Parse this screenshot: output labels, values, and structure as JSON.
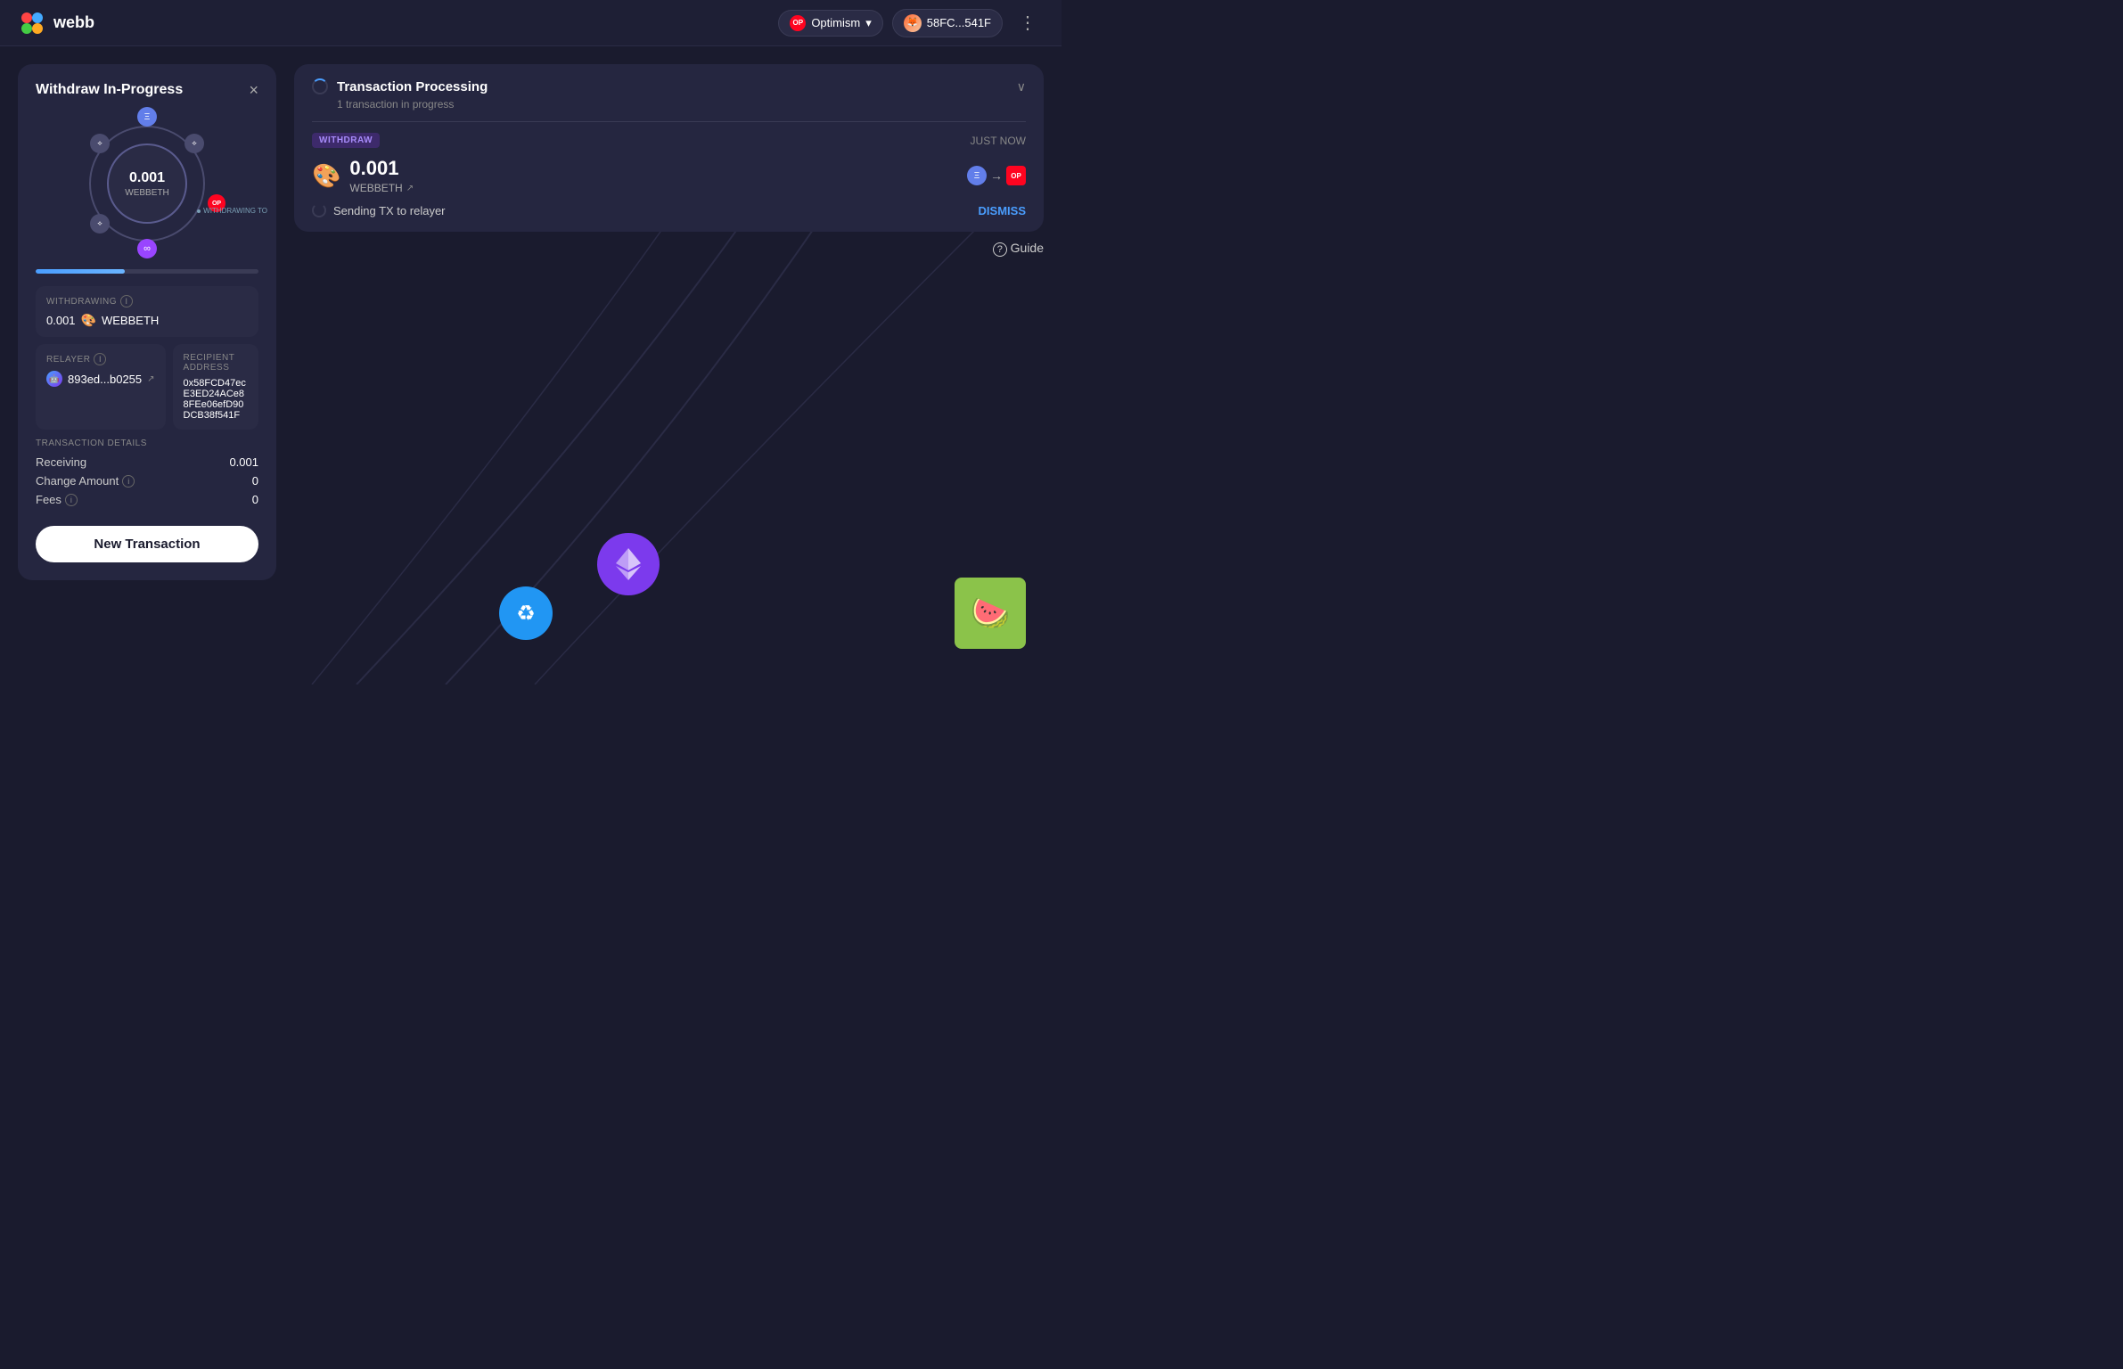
{
  "app": {
    "name": "webb",
    "logo_text": "webb"
  },
  "header": {
    "network_label": "Optimism",
    "wallet_address": "58FC...541F",
    "more_icon": "⋮"
  },
  "withdraw_panel": {
    "title": "Withdraw In-Progress",
    "close_icon": "×",
    "amount": "0.001",
    "token": "WEBBETH",
    "withdrawing_to_label": "WITHDRAWING TO",
    "progress_percent": 40,
    "withdrawing_section": {
      "label": "WITHDRAWING",
      "value": "0.001",
      "token": "WEBBETH"
    },
    "relayer_section": {
      "label": "RELAYER",
      "value": "893ed...b0255",
      "external_icon": "↗"
    },
    "recipient_section": {
      "label": "RECIPIENT ADDRESS",
      "value": "0x58FCD47ecE3ED24ACe88FEe06efD90DCB38f541F"
    },
    "transaction_details": {
      "title": "TRANSACTION DETAILS",
      "receiving_label": "Receiving",
      "receiving_value": "0.001",
      "change_amount_label": "Change Amount",
      "change_amount_value": "0",
      "fees_label": "Fees",
      "fees_value": "0"
    },
    "new_transaction_btn": "New Transaction"
  },
  "tx_processing": {
    "title": "Transaction Processing",
    "subtitle": "1 transaction in progress",
    "withdraw_badge": "WITHDRAW",
    "just_now": "JUST NOW",
    "amount": "0.001",
    "token": "WEBBETH",
    "sending_tx_label": "Sending TX to relayer",
    "dismiss_btn": "DISMISS"
  },
  "guide": {
    "label": "Guide",
    "icon": "?"
  },
  "icons": {
    "eth_node": "Ξ",
    "op_node": "OP",
    "inf_node": "∞",
    "eth_diamond": "⟡"
  }
}
